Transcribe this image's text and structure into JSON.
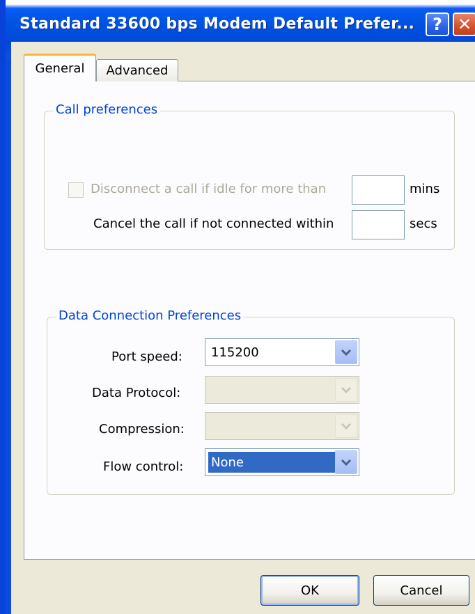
{
  "window": {
    "title": "Standard 33600 bps Modem Default Prefer...",
    "help_glyph": "?",
    "close_glyph": "✕"
  },
  "tabs": [
    {
      "label": "General",
      "selected": true
    },
    {
      "label": "Advanced",
      "selected": false
    }
  ],
  "call_preferences": {
    "legend": "Call preferences",
    "disconnect_label": "Disconnect a call if idle for more than",
    "disconnect_checked": false,
    "disconnect_enabled": false,
    "disconnect_value": "",
    "disconnect_unit": "mins",
    "cancel_label": "Cancel the call if not connected within",
    "cancel_value": "",
    "cancel_unit": "secs"
  },
  "data_connection": {
    "legend": "Data Connection Preferences",
    "port_speed_label": "Port speed:",
    "port_speed_value": "115200",
    "data_protocol_label": "Data Protocol:",
    "data_protocol_value": "",
    "compression_label": "Compression:",
    "compression_value": "",
    "flow_control_label": "Flow control:",
    "flow_control_value": "None"
  },
  "buttons": {
    "ok": "OK",
    "cancel": "Cancel"
  },
  "colors": {
    "titlebar": "#0054e3",
    "group_legend": "#0046d5",
    "selection": "#316ac5",
    "tab_highlight": "#f6b73c"
  }
}
